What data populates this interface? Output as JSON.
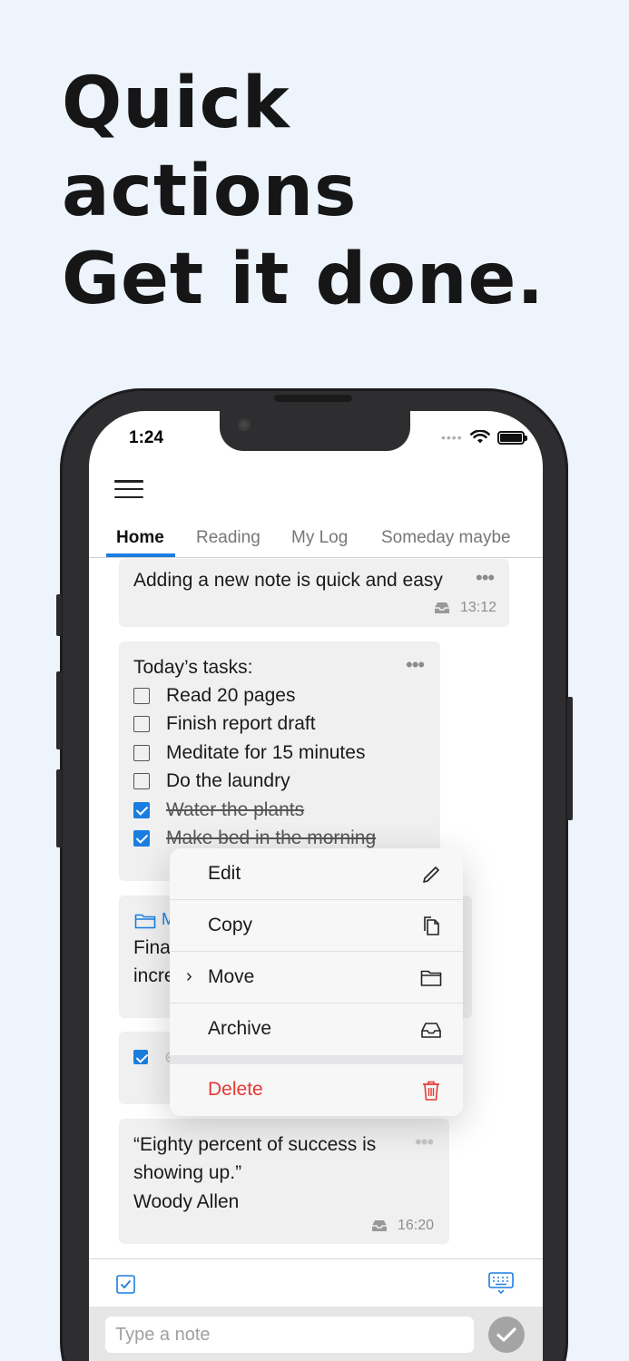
{
  "headline": {
    "line1": "Quick",
    "line2": "actions",
    "line3": "Get it done."
  },
  "status_bar": {
    "time": "1:24"
  },
  "tabs": [
    {
      "label": "Home"
    },
    {
      "label": "Reading"
    },
    {
      "label": "My Log"
    },
    {
      "label": "Someday maybe"
    }
  ],
  "notes": {
    "first": {
      "text": "Adding a new note is quick and easy",
      "time": "13:12"
    },
    "tasks": {
      "title": "Today’s tasks:",
      "items": [
        {
          "label": "Read 20 pages",
          "done": false
        },
        {
          "label": "Finish report draft",
          "done": false
        },
        {
          "label": "Meditate for 15 minutes",
          "done": false
        },
        {
          "label": "Do the laundry",
          "done": false
        },
        {
          "label": "Water the plants",
          "done": true
        },
        {
          "label": "Make bed in the morning",
          "done": true
        }
      ]
    },
    "folder_card": {
      "folder_label": "M",
      "line1": "Fina",
      "line2": "incre"
    },
    "quote": {
      "line1": "“Eighty percent of success is",
      "line2": "showing up.”",
      "line3": "Woody Allen",
      "time": "16:20"
    }
  },
  "context_menu": {
    "items": [
      {
        "label": "Edit",
        "icon": "pencil-icon"
      },
      {
        "label": "Copy",
        "icon": "copy-icon"
      },
      {
        "label": "Move",
        "icon": "folder-icon"
      },
      {
        "label": "Archive",
        "icon": "archive-tray-icon"
      }
    ],
    "delete": {
      "label": "Delete",
      "icon": "trash-icon"
    }
  },
  "composer": {
    "placeholder": "Type a note"
  },
  "colors": {
    "accent": "#1a7ee0",
    "danger": "#e53935",
    "background": "#eef4fb"
  }
}
